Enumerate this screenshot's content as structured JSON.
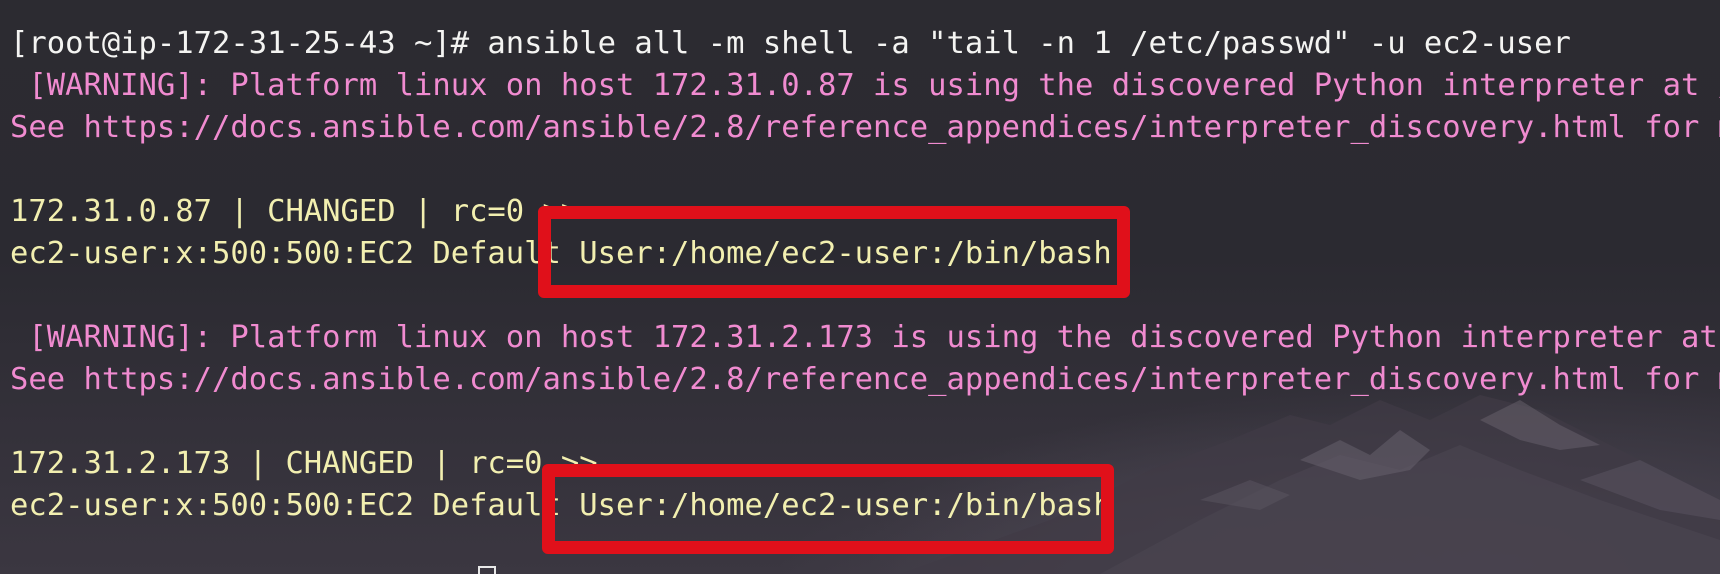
{
  "terminal": {
    "prompt_line": "[root@ip-172-31-25-43 ~]# ansible all -m shell -a \"tail -n 1 /etc/passwd\" -u ec2-user",
    "host1": {
      "warning": " [WARNING]: Platform linux on host 172.31.0.87 is using the discovered Python interpreter at /u",
      "see": "See https://docs.ansible.com/ansible/2.8/reference_appendices/interpreter_discovery.html for mo",
      "status": "172.31.0.87 | CHANGED | rc=0 >>",
      "output": "ec2-user:x:500:500:EC2 Default User:/home/ec2-user:/bin/bash"
    },
    "host2": {
      "warning": " [WARNING]: Platform linux on host 172.31.2.173 is using the discovered Python interpreter at /",
      "see": "See https://docs.ansible.com/ansible/2.8/reference_appendices/interpreter_discovery.html for mo",
      "status": "172.31.2.173 | CHANGED | rc=0 >>",
      "output": "ec2-user:x:500:500:EC2 Default User:/home/ec2-user:/bin/bash"
    }
  },
  "colors": {
    "command_text": "#f4f4f2",
    "warning_text": "#f08bd0",
    "output_text": "#f2efb0",
    "highlight_border": "#e0101a",
    "background": "#2a2930"
  }
}
